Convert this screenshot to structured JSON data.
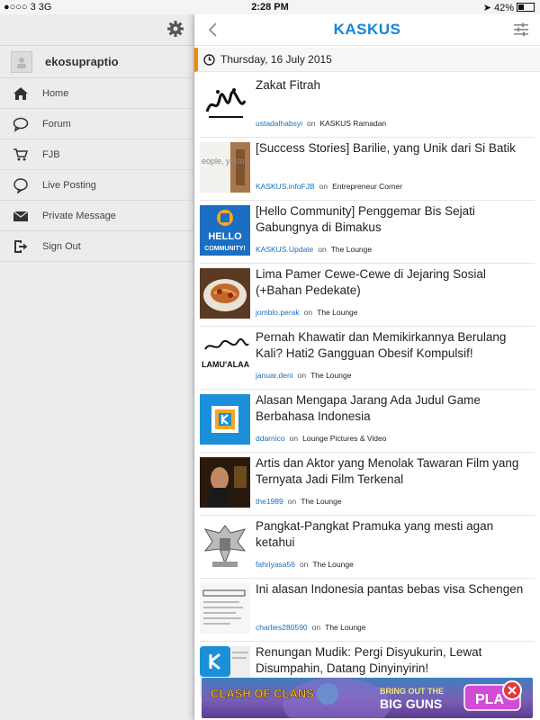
{
  "status": {
    "carrier": "●○○○ 3  3G",
    "time": "2:28 PM",
    "battery": "42%"
  },
  "sidebar": {
    "username": "ekosupraptio",
    "items": [
      {
        "label": "Home",
        "icon": "home-icon"
      },
      {
        "label": "Forum",
        "icon": "chat-bubble-icon"
      },
      {
        "label": "FJB",
        "icon": "cart-icon"
      },
      {
        "label": "Live Posting",
        "icon": "speech-icon"
      },
      {
        "label": "Private Message",
        "icon": "envelope-icon"
      },
      {
        "label": "Sign Out",
        "icon": "sign-out-icon"
      }
    ]
  },
  "header": {
    "logo_part1": "K",
    "logo_part2": "ASKUS"
  },
  "date": "Thursday, 16 July 2015",
  "threads": [
    {
      "title": "Zakat Fitrah",
      "user": "ustadalhabsyi",
      "on": "on",
      "forum": "KASKUS Ramadan"
    },
    {
      "title": "[Success Stories] Barilie, yang Unik dari Si Batik",
      "user": "KASKUS.infoFJB",
      "on": "on",
      "forum": "Entrepreneur Corner"
    },
    {
      "title": "[Hello Community] Penggemar Bis Sejati Gabungnya di Bimakus",
      "user": "KASKUS.Update",
      "on": "on",
      "forum": "The Lounge"
    },
    {
      "title": "Lima Pamer Cewe-Cewe di Jejaring Sosial (+Bahan Pedekate)",
      "user": "jomblo.perak",
      "on": "on",
      "forum": "The Lounge"
    },
    {
      "title": "Pernah Khawatir dan Memikirkannya Berulang Kali? Hati2 Gangguan Obesif Kompulsif!",
      "user": "januar.deni",
      "on": "on",
      "forum": "The Lounge"
    },
    {
      "title": "Alasan Mengapa Jarang Ada Judul Game Berbahasa Indonesia",
      "user": "ddarnico",
      "on": "on",
      "forum": "Lounge Pictures & Video"
    },
    {
      "title": "Artis dan Aktor yang Menolak Tawaran Film yang Ternyata Jadi Film Terkenal",
      "user": "the1989",
      "on": "on",
      "forum": "The Lounge"
    },
    {
      "title": "Pangkat-Pangkat Pramuka yang mesti agan ketahui",
      "user": "fahriyasa56",
      "on": "on",
      "forum": "The Lounge"
    },
    {
      "title": "Ini alasan Indonesia pantas bebas visa Schengen",
      "user": "charlies280590",
      "on": "on",
      "forum": "The Lounge"
    },
    {
      "title": "Renungan Mudik: Pergi Disyukurin, Lewat Disumpahin, Datang Dinyinyirin!",
      "user": "",
      "on": "",
      "forum": ""
    }
  ],
  "thumb_texts": {
    "t2": "eople, y Stories",
    "t3a": "HELLO",
    "t3b": "COMMUNITY!",
    "t5": "LAMU'ALAA"
  },
  "ad": {
    "left": "CLASH OF CLANS",
    "mid1": "BRING OUT THE",
    "mid2": "BIG GUNS",
    "play": "PLA"
  },
  "colors": {
    "kaskus_blue": "#1484d6",
    "accent_orange": "#f28b00",
    "link_blue": "#1a6fbf"
  }
}
